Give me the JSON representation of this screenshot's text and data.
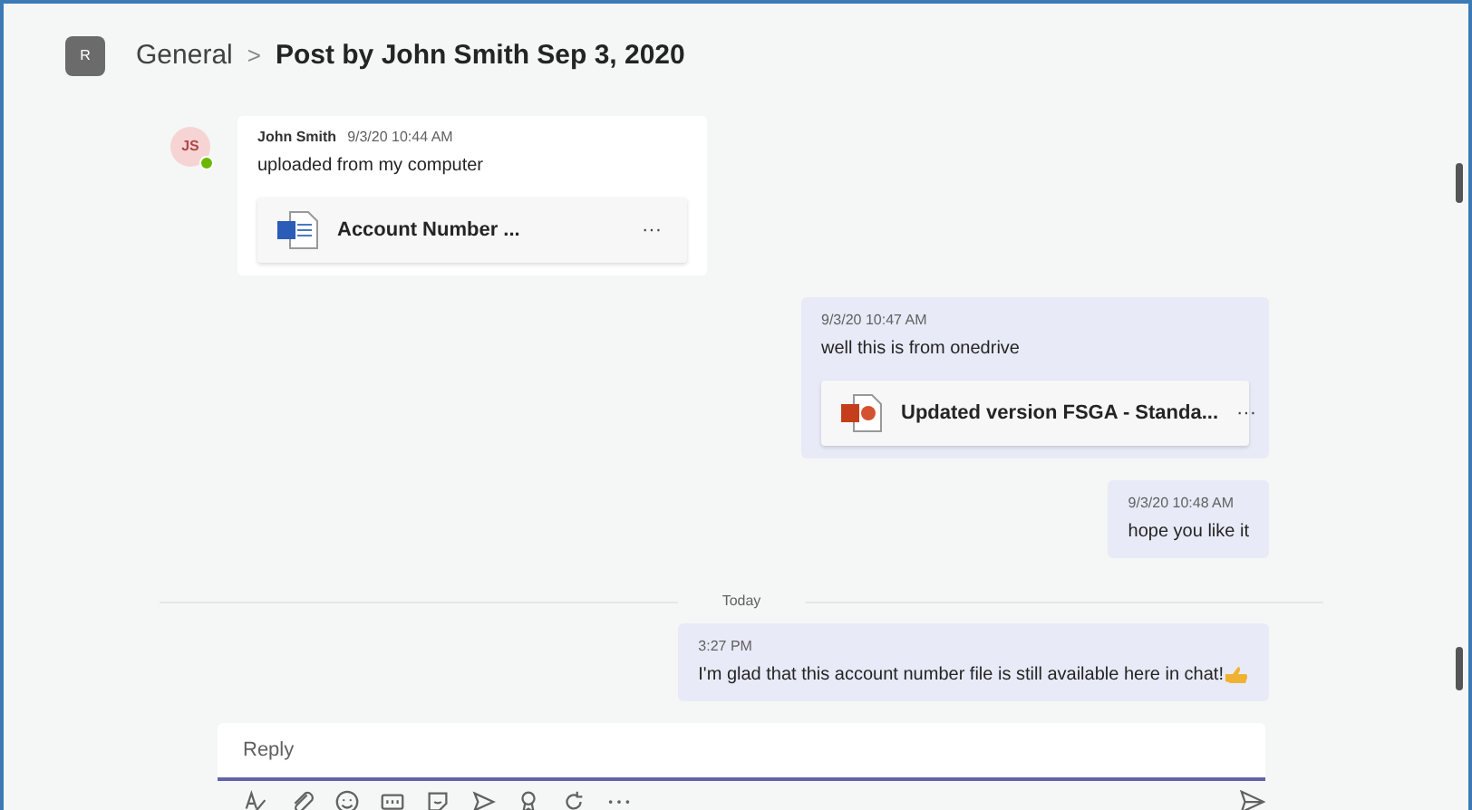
{
  "header": {
    "team_initial": "R",
    "channel": "General",
    "separator": ">",
    "title": "Post by John Smith Sep 3, 2020"
  },
  "messages": [
    {
      "kind": "received",
      "avatar": "JS",
      "online": true,
      "author": "John Smith",
      "time": "9/3/20 10:44 AM",
      "text": "uploaded from my computer",
      "attachment": {
        "kind": "word",
        "name": "Account Number ...",
        "more": "···"
      }
    },
    {
      "kind": "sent",
      "time": "9/3/20 10:47 AM",
      "text": "well this is from onedrive",
      "attachment": {
        "kind": "powerpoint",
        "name": "Updated version FSGA - Standa...",
        "more": "···"
      }
    },
    {
      "kind": "sent",
      "time": "9/3/20 10:48 AM",
      "text": "hope you like it"
    },
    {
      "kind": "divider",
      "text": "Today"
    },
    {
      "kind": "sent",
      "time": "3:27 PM",
      "text": "I'm glad that this account number file is still available here in chat!",
      "emoji": true
    }
  ],
  "reply": {
    "placeholder": "Reply"
  }
}
